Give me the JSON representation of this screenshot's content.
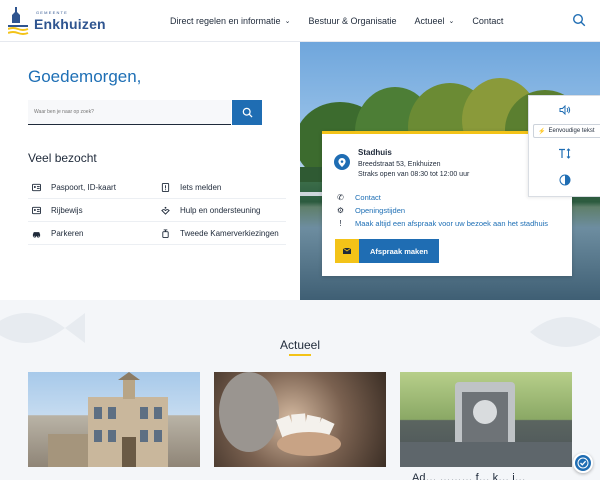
{
  "header": {
    "logo_small": "GEMEENTE",
    "logo_name": "Enkhuizen",
    "nav": [
      {
        "label": "Direct regelen en informatie",
        "has_menu": true
      },
      {
        "label": "Bestuur & Organisatie",
        "has_menu": false
      },
      {
        "label": "Actueel",
        "has_menu": true
      },
      {
        "label": "Contact",
        "has_menu": false
      }
    ],
    "search_icon": "search-icon"
  },
  "main": {
    "greeting": "Goedemorgen,",
    "search_placeholder": "Waar ben je naar op zoek?",
    "popular_title": "Veel bezocht",
    "links": [
      {
        "label": "Paspoort, ID-kaart",
        "icon": "id-card-icon"
      },
      {
        "label": "Iets melden",
        "icon": "report-icon"
      },
      {
        "label": "Rijbewijs",
        "icon": "license-icon"
      },
      {
        "label": "Hulp en ondersteuning",
        "icon": "support-icon"
      },
      {
        "label": "Parkeren",
        "icon": "car-icon"
      },
      {
        "label": "Tweede Kamerverkiezingen",
        "icon": "ballot-icon"
      }
    ]
  },
  "card": {
    "title": "Stadhuis",
    "address": "Breedstraat 53, Enkhuizen",
    "opening": "Straks open van 08:30 tot 12:00 uur",
    "contact": "Contact",
    "hours": "Openingstijden",
    "notice": "Maak altijd een afspraak voor uw bezoek aan het stadhuis",
    "cta": "Afspraak maken"
  },
  "a11y": {
    "easy_text": "Eenvoudige tekst"
  },
  "news": {
    "title": "Actueel",
    "caption": "Ad… ……… f… k… i…"
  },
  "colors": {
    "primary": "#1f6db3",
    "accent": "#f3c318",
    "text": "#1f2a3a"
  }
}
